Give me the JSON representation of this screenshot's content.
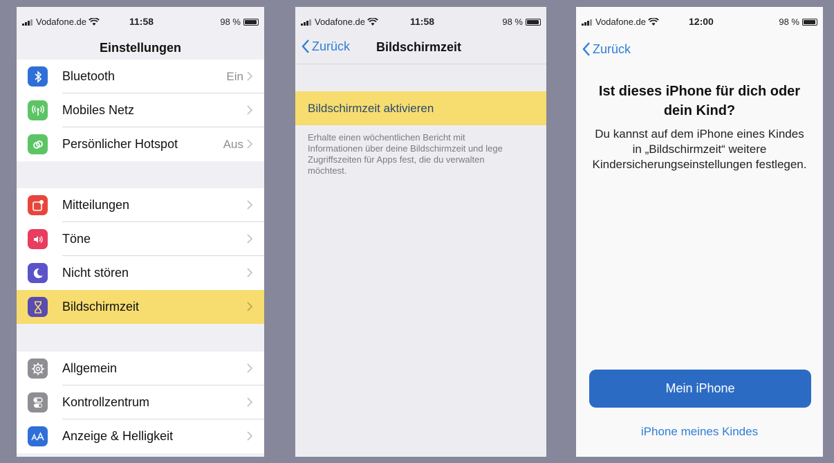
{
  "screen1": {
    "status": {
      "carrier": "Vodafone.de",
      "time": "11:58",
      "battery": "98 %"
    },
    "title": "Einstellungen",
    "group1": [
      {
        "label": "Bluetooth",
        "value": "Ein",
        "icon": "bluetooth-icon",
        "color": "#2f6fd8"
      },
      {
        "label": "Mobiles Netz",
        "value": "",
        "icon": "antenna-icon",
        "color": "#5dc466"
      },
      {
        "label": "Persönlicher Hotspot",
        "value": "Aus",
        "icon": "hotspot-icon",
        "color": "#5dc466"
      }
    ],
    "group2": [
      {
        "label": "Mitteilungen",
        "icon": "notifications-icon",
        "color": "#e8463c"
      },
      {
        "label": "Töne",
        "icon": "sounds-icon",
        "color": "#e83d5f"
      },
      {
        "label": "Nicht stören",
        "icon": "moon-icon",
        "color": "#5c52c9"
      },
      {
        "label": "Bildschirmzeit",
        "icon": "hourglass-icon",
        "color": "#5a4bb0"
      }
    ],
    "group3": [
      {
        "label": "Allgemein",
        "icon": "gear-icon",
        "color": "#8e8e93"
      },
      {
        "label": "Kontrollzentrum",
        "icon": "toggles-icon",
        "color": "#8e8e93"
      },
      {
        "label": "Anzeige & Helligkeit",
        "icon": "text-size-icon",
        "color": "#2f6fd8"
      }
    ]
  },
  "screen2": {
    "status": {
      "carrier": "Vodafone.de",
      "time": "11:58",
      "battery": "98 %"
    },
    "back": "Zurück",
    "title": "Bildschirmzeit",
    "activate": "Bildschirmzeit aktivieren",
    "description": "Erhalte einen wöchentlichen Bericht mit Informationen über deine Bildschirmzeit und lege Zugriffszeiten für Apps fest, die du verwalten möchtest."
  },
  "screen3": {
    "status": {
      "carrier": "Vodafone.de",
      "time": "12:00",
      "battery": "98 %"
    },
    "back": "Zurück",
    "question": "Ist dieses iPhone für dich oder dein Kind?",
    "subtitle": "Du kannst auf dem iPhone eines Kindes in „Bildschirmzeit“ weitere Kindersicherungseinstellungen festlegen.",
    "primary_button": "Mein iPhone",
    "secondary_link": "iPhone meines Kindes"
  },
  "colors": {
    "highlight": "#f7dc6f",
    "accent": "#2f7dd6",
    "button": "#2c6bc4"
  }
}
